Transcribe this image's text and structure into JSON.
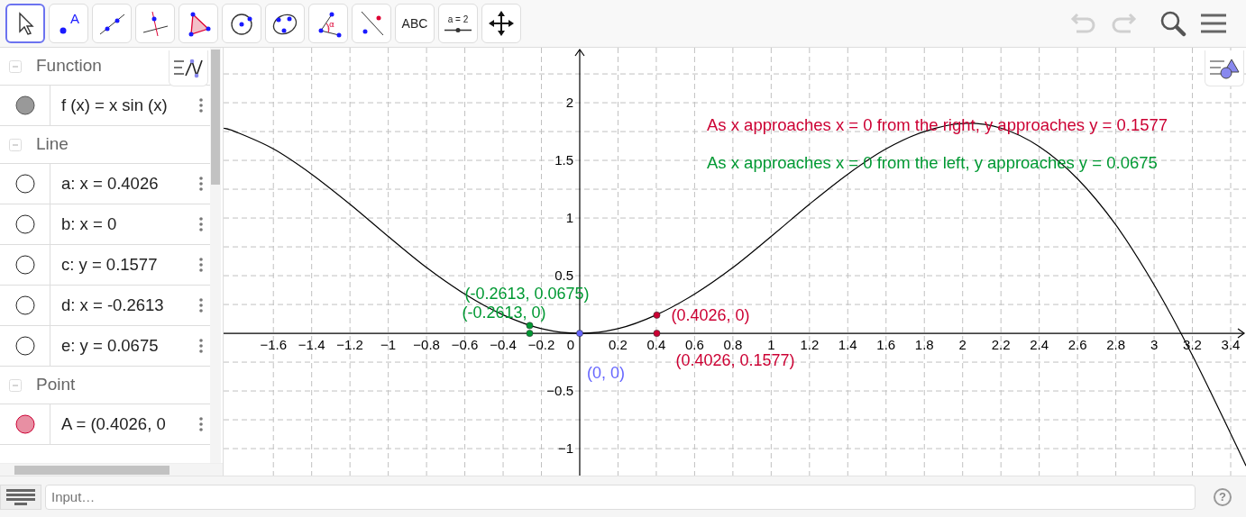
{
  "toolbar": {
    "tools": [
      {
        "kind": "move",
        "selected": true
      },
      {
        "kind": "point",
        "label": "A",
        "selected": false
      },
      {
        "kind": "line",
        "selected": false
      },
      {
        "kind": "perpendicular",
        "selected": false
      },
      {
        "kind": "polygon",
        "selected": false
      },
      {
        "kind": "circle",
        "selected": false
      },
      {
        "kind": "conic",
        "selected": false
      },
      {
        "kind": "angle",
        "label": "α",
        "selected": false
      },
      {
        "kind": "reflect",
        "selected": false
      },
      {
        "kind": "text",
        "label": "ABC",
        "selected": false
      },
      {
        "kind": "slider",
        "label": "a = 2",
        "selected": false
      },
      {
        "kind": "pan",
        "selected": false
      }
    ],
    "undo": {
      "disabled": true
    },
    "redo": {
      "disabled": true
    }
  },
  "algebra": {
    "groups": [
      {
        "title": "Function",
        "expanded": true,
        "items": [
          {
            "text": "f (x) = x sin (x)",
            "shown": true,
            "color": "#999999"
          }
        ]
      },
      {
        "title": "Line",
        "expanded": true,
        "items": [
          {
            "text": "a: x = 0.4026",
            "shown": false
          },
          {
            "text": "b: x = 0",
            "shown": false
          },
          {
            "text": "c: y = 0.1577",
            "shown": false
          },
          {
            "text": "d: x = -0.2613",
            "shown": false
          },
          {
            "text": "e: y = 0.0675",
            "shown": false
          }
        ]
      },
      {
        "title": "Point",
        "expanded": true,
        "items": [
          {
            "text": "A = (0.4026, 0",
            "shown": true,
            "color": "#e88fa3"
          }
        ]
      }
    ]
  },
  "graphics": {
    "statements": [
      {
        "text": "As x approaches x = 0 from the right, y approaches y = 0.1577",
        "color": "#cc0033"
      },
      {
        "text": "As x approaches x = 0 from the left, y approaches y = 0.0675",
        "color": "#009933"
      }
    ],
    "chart_data": {
      "type": "line",
      "grid": true,
      "xlim": [
        -1.86,
        3.48
      ],
      "ylim": [
        -1.234,
        2.477
      ],
      "xticks": [
        {
          "value": -1.6,
          "label": "−1.6"
        },
        {
          "value": -1.4,
          "label": "−1.4"
        },
        {
          "value": -1.2,
          "label": "−1.2"
        },
        {
          "value": -1,
          "label": "−1"
        },
        {
          "value": -0.8,
          "label": "−0.8"
        },
        {
          "value": -0.6,
          "label": "−0.6"
        },
        {
          "value": -0.4,
          "label": "−0.4"
        },
        {
          "value": -0.2,
          "label": "−0.2"
        },
        0.2,
        0.4,
        0.6,
        0.8,
        1,
        1.2,
        1.4,
        1.6,
        1.8,
        2,
        2.2,
        2.4,
        2.6,
        2.8,
        3,
        3.2,
        3.4
      ],
      "yticks": [
        {
          "value": -1,
          "label": "−1"
        },
        {
          "value": -0.5,
          "label": "−0.5"
        },
        0.5,
        1,
        1.5,
        2
      ],
      "x": [
        -1.86,
        -1.8,
        -1.6,
        -1.4,
        -1.2,
        -1,
        -0.8,
        -0.6,
        -0.4,
        -0.2,
        0,
        0.2,
        0.4,
        0.6,
        0.8,
        1,
        1.2,
        1.4,
        1.6,
        1.8,
        2,
        2.2,
        2.4,
        2.6,
        2.8,
        3,
        3.2,
        3.4,
        3.48
      ],
      "series": [
        {
          "color": "#000000",
          "values": [
            1.78,
            1.75,
            1.6,
            1.38,
            1.12,
            0.84,
            0.57,
            0.34,
            0.16,
            0.04,
            0,
            0.04,
            0.16,
            0.34,
            0.57,
            0.84,
            1.12,
            1.38,
            1.6,
            1.75,
            1.82,
            1.78,
            1.62,
            1.34,
            0.94,
            0.42,
            -0.19,
            -0.87,
            -1.15
          ]
        }
      ],
      "annotations": [
        {
          "x": -0.2613,
          "y": 0.0675,
          "text": "(-0.2613, 0.0675)"
        },
        {
          "x": -0.2613,
          "y": 0,
          "text": "(-0.2613, 0)"
        },
        {
          "x": 0.4026,
          "y": 0,
          "text": "(0.4026, 0)"
        },
        {
          "x": 0.4026,
          "y": 0.1577,
          "text": "(0.4026, 0.1577)"
        },
        {
          "x": 0,
          "y": 0,
          "text": "(0, 0)"
        }
      ]
    },
    "origin_label": "0",
    "points": [
      {
        "color": "#009933"
      },
      {
        "color": "#009933"
      },
      {
        "color": "#cc0033"
      },
      {
        "color": "#cc0033"
      },
      {
        "color": "#6666ff"
      }
    ]
  },
  "input_bar": {
    "placeholder": "Input…",
    "help": "?"
  }
}
